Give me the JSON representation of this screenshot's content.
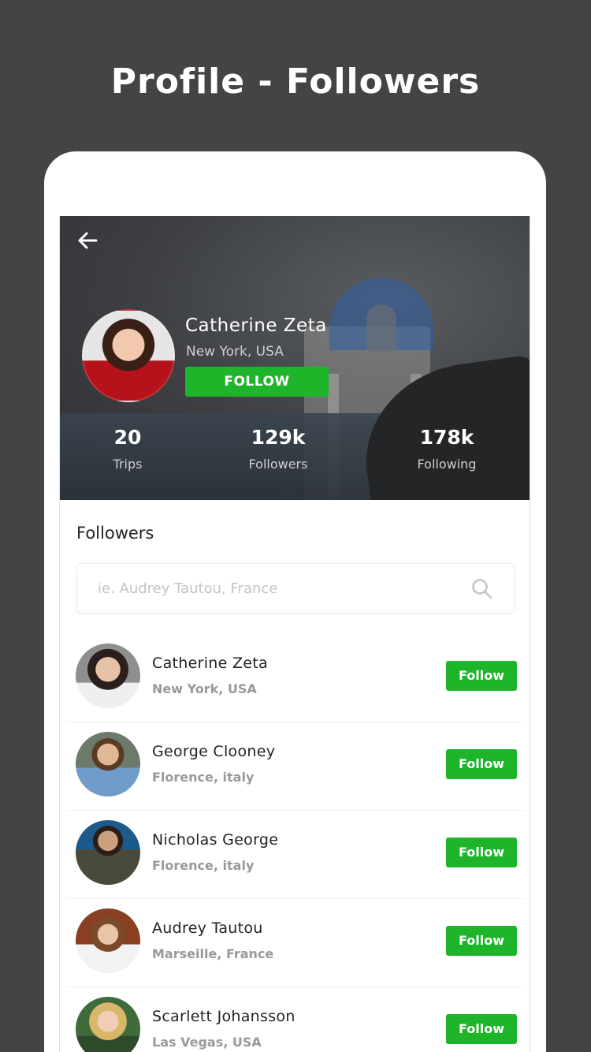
{
  "page_heading": "Profile - Followers",
  "header": {
    "back_icon": "arrow-left-icon",
    "profile": {
      "name": "Catherine Zeta",
      "location": "New York, USA",
      "follow_label": "FOLLOW"
    },
    "stats": [
      {
        "value": "20",
        "label": "Trips"
      },
      {
        "value": "129k",
        "label": "Followers"
      },
      {
        "value": "178k",
        "label": "Following"
      }
    ]
  },
  "followers": {
    "title": "Followers",
    "search": {
      "placeholder": "ie. Audrey Tautou, France",
      "icon": "search-icon"
    },
    "items": [
      {
        "name": "Catherine Zeta",
        "location": "New York, USA",
        "button": "Follow"
      },
      {
        "name": "George Clooney",
        "location": "Florence, italy",
        "button": "Follow"
      },
      {
        "name": "Nicholas George",
        "location": "Florence, italy",
        "button": "Follow"
      },
      {
        "name": "Audrey Tautou",
        "location": "Marseille, France",
        "button": "Follow"
      },
      {
        "name": "Scarlett Johansson",
        "location": "Las Vegas, USA",
        "button": "Follow"
      }
    ]
  },
  "colors": {
    "page_background": "#444444",
    "accent_green": "#1fb52b"
  }
}
